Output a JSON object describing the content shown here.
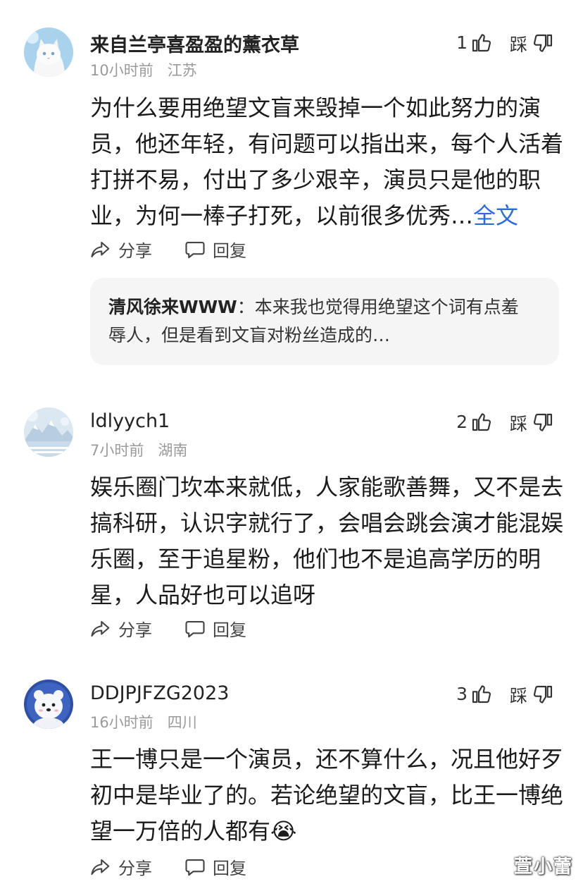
{
  "comments": [
    {
      "username": "来自兰亭喜盈盈的薰衣草",
      "time": "10小时前",
      "location": "江苏",
      "likes": "1",
      "dislike_label": "踩",
      "avatar_icon": "white-cat-avatar",
      "text": "为什么要用绝望文盲来毁掉一个如此努力的演员，他还年轻，有问题可以指出来，每个人活着打拼不易，付出了多少艰辛，演员只是他的职业，为何一棒子打死，以前很多优秀…",
      "more_label": "全文",
      "share_label": "分享",
      "reply_label": "回复",
      "reply": {
        "name": "清风徐来WWW",
        "text": "：本来我也觉得用绝望这个词有点羞辱人，但是看到文盲对粉丝造成的…"
      }
    },
    {
      "username": "ldlyych1",
      "time": "7小时前",
      "location": "湖南",
      "likes": "2",
      "dislike_label": "踩",
      "avatar_icon": "snow-mountain-avatar",
      "text": "娱乐圈门坎本来就低，人家能歌善舞，又不是去搞科研，认识字就行了，会唱会跳会演才能混娱乐圈，至于追星粉，他们也不是追高学历的明星，人品好也可以追呀",
      "share_label": "分享",
      "reply_label": "回复"
    },
    {
      "username": "DDJPJFZG2023",
      "time": "16小时前",
      "location": "四川",
      "likes": "3",
      "dislike_label": "踩",
      "avatar_icon": "polar-bear-avatar",
      "text": "王一博只是一个演员，还不算什么，况且他好歹初中是毕业了的。若论绝望的文盲，比王一博绝望一万倍的人都有",
      "emoji": "😭",
      "share_label": "分享",
      "reply_label": "回复"
    }
  ],
  "watermark": "萱小蕾",
  "colors": {
    "link": "#2f6bd6",
    "meta": "#9a9a9a",
    "reply_bg": "#f5f5f5"
  }
}
